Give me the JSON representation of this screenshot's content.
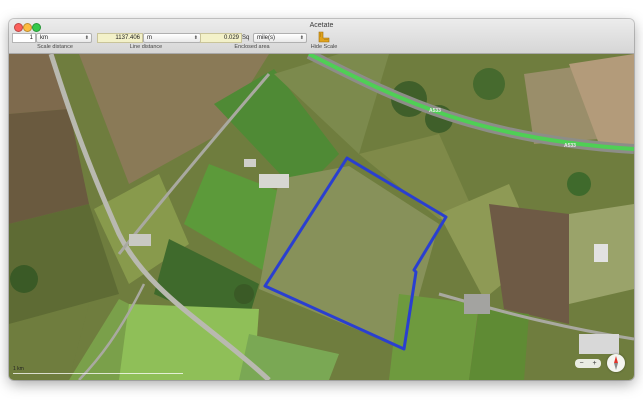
{
  "window": {
    "title": "Acetate"
  },
  "toolbar": {
    "scale_distance": {
      "value": "1",
      "unit": "km",
      "caption": "Scale distance"
    },
    "line_distance": {
      "value": "1137.406",
      "unit": "m",
      "caption": "Line distance"
    },
    "enclosed_area": {
      "value": "0.029",
      "prefix": "Sq",
      "unit": "mile(s)",
      "caption": "Enclosed area"
    },
    "hide_scale": {
      "caption": "Hide Scale"
    }
  },
  "map": {
    "road_labels": [
      "A533",
      "A533"
    ],
    "scale_label": "1 km",
    "zoom_out": "−",
    "zoom_in": "+"
  },
  "colors": {
    "polygon": "#2a3fd0",
    "road_highlight": "#4fcf55",
    "field_readonly": "#f3f1c9"
  }
}
